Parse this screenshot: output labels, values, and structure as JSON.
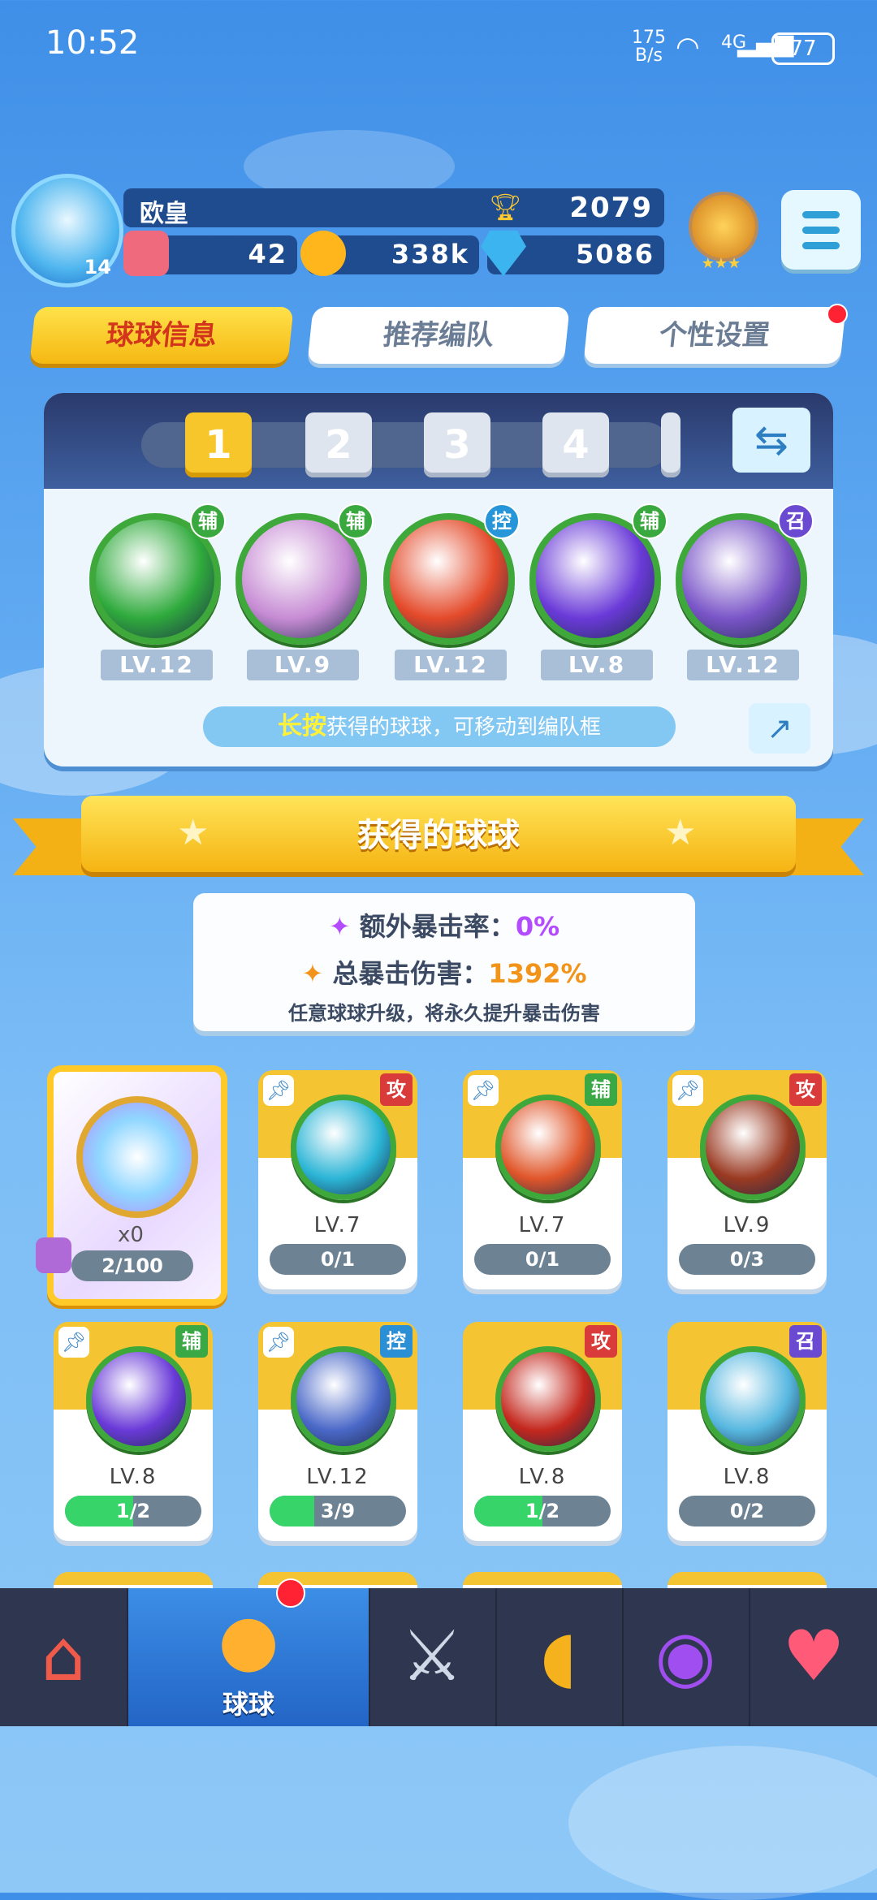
{
  "status_bar": {
    "time": "10:52",
    "net_speed_value": "175",
    "net_speed_unit": "B/s",
    "network": "4G",
    "battery": "77"
  },
  "player": {
    "name": "欧皇",
    "level": "14",
    "trophies": "2079",
    "tickets": "42",
    "coins": "338k",
    "gems": "5086"
  },
  "tabs": [
    {
      "label": "球球信息",
      "active": true
    },
    {
      "label": "推荐编队",
      "active": false
    },
    {
      "label": "个性设置",
      "active": false,
      "has_dot": true
    }
  ],
  "team": {
    "slots": [
      "1",
      "2",
      "3",
      "4"
    ],
    "active_slot": "1",
    "balls": [
      {
        "tag": "辅",
        "level": "LV.12",
        "color": "#2faa3c"
      },
      {
        "tag": "辅",
        "level": "LV.9",
        "color": "#c78cd4"
      },
      {
        "tag": "控",
        "level": "LV.12",
        "color": "#e44a2a"
      },
      {
        "tag": "辅",
        "level": "LV.8",
        "color": "#6a3ad8"
      },
      {
        "tag": "召",
        "level": "LV.12",
        "color": "#7a55c8"
      }
    ],
    "hint_highlight": "长按",
    "hint_text": "获得的球球，可移动到编队框"
  },
  "section_title": "获得的球球",
  "crit": {
    "extra_label": "额外暴击率：",
    "extra_value": "0%",
    "total_label": "总暴击伤害：",
    "total_value": "1392%",
    "note": "任意球球升级，将永久提升暴击伤害"
  },
  "special_card": {
    "count": "x0",
    "progress": "2/100"
  },
  "cards": [
    {
      "tag": "攻",
      "tag_color": "red",
      "level": "LV.7",
      "progress": "0/1",
      "fill": 0,
      "color": "#2bb5d6"
    },
    {
      "tag": "辅",
      "tag_color": "green",
      "level": "LV.7",
      "progress": "0/1",
      "fill": 0,
      "color": "#e0562a"
    },
    {
      "tag": "攻",
      "tag_color": "red",
      "level": "LV.9",
      "progress": "0/3",
      "fill": 0,
      "color": "#9a3a22"
    },
    {
      "tag": "辅",
      "tag_color": "green",
      "level": "LV.8",
      "progress": "1/2",
      "fill": 0.5,
      "color": "#6a3ad8"
    },
    {
      "tag": "控",
      "tag_color": "blue",
      "level": "LV.12",
      "progress": "3/9",
      "fill": 0.33,
      "color": "#4a68c8"
    },
    {
      "tag": "攻",
      "tag_color": "red",
      "level": "LV.8",
      "progress": "1/2",
      "fill": 0.5,
      "color": "#c4281e"
    },
    {
      "tag": "召",
      "tag_color": "purple",
      "level": "LV.8",
      "progress": "0/2",
      "fill": 0,
      "color": "#58b8e0"
    }
  ],
  "nav": [
    {
      "icon": "shop-icon",
      "label": ""
    },
    {
      "icon": "balls-icon",
      "label": "球球",
      "active": true
    },
    {
      "icon": "swords-icon",
      "label": ""
    },
    {
      "icon": "whistle-icon",
      "label": ""
    },
    {
      "icon": "planet-icon",
      "label": ""
    },
    {
      "icon": "social-icon",
      "label": ""
    }
  ]
}
